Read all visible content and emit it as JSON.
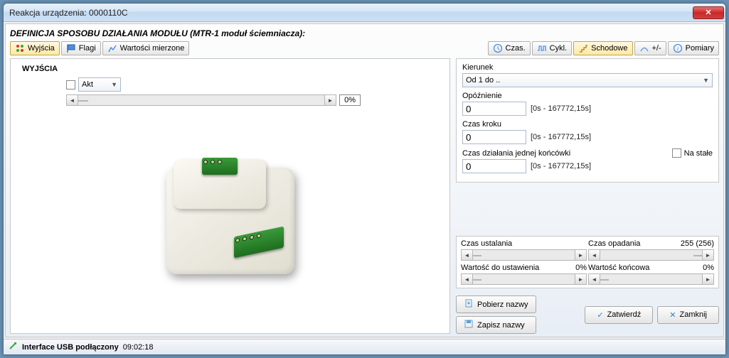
{
  "window": {
    "title": "Reakcja urządzenia: 0000110C"
  },
  "heading": "DEFINICJA SPOSOBU DZIAŁANIA MODUŁU (MTR-1 moduł ściemniacza):",
  "left_tabs": {
    "outputs": "Wyjścia",
    "flags": "Flagi",
    "measured": "Wartości mierzone"
  },
  "right_tabs": {
    "czas": "Czas.",
    "cykl": "Cykl.",
    "schodowe": "Schodowe",
    "plusminus": "+/-",
    "pomiary": "Pomiary"
  },
  "outputs": {
    "section_title": "WYJŚCIA",
    "akt_label": "Akt",
    "percent": "0%"
  },
  "direction": {
    "label": "Kierunek",
    "value": "Od 1 do .."
  },
  "delay": {
    "label": "Opóźnienie",
    "value": "0",
    "hint": "[0s - 167772,15s]"
  },
  "step_time": {
    "label": "Czas kroku",
    "value": "0",
    "hint": "[0s - 167772,15s]"
  },
  "end_time": {
    "label": "Czas działania jednej końcówki",
    "permanent_label": "Na stałe",
    "value": "0",
    "hint": "[0s - 167772,15s]"
  },
  "setup_time": {
    "label": "Czas ustalania",
    "value": ""
  },
  "fall_time": {
    "label": "Czas opadania",
    "value": "255 (256)"
  },
  "set_value": {
    "label": "Wartość do ustawienia",
    "value": "0%"
  },
  "end_value": {
    "label": "Wartość końcowa",
    "value": "0%"
  },
  "buttons": {
    "get_names": "Pobierz nazwy",
    "save_names": "Zapisz nazwy",
    "confirm": "Zatwierdź",
    "close": "Zamknij"
  },
  "status": {
    "text": "Interface USB podłączony",
    "time": "09:02:18"
  }
}
